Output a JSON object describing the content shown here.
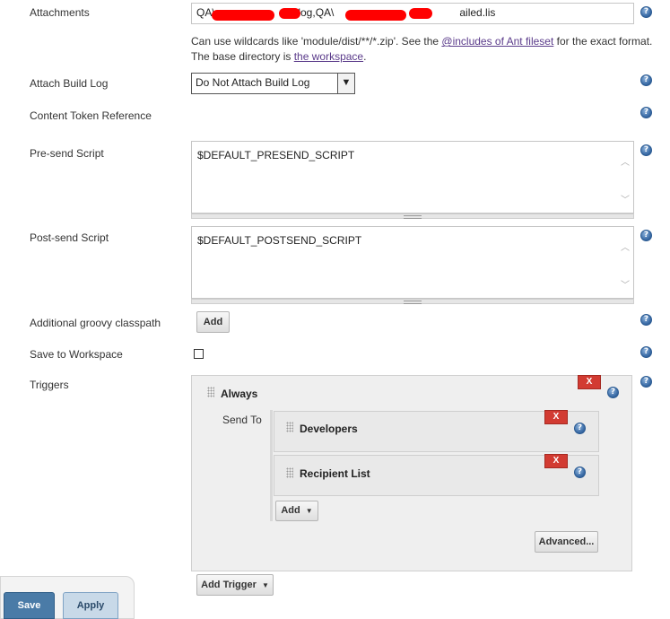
{
  "attachments": {
    "label": "Attachments",
    "value_part1": "QA\\",
    "value_part2": "t.log,QA\\",
    "value_part3": "ailed.lis",
    "hint_line1_pre": "Can use wildcards like 'module/dist/**/*.zip'. See the ",
    "hint_link1": "@includes of Ant fileset",
    "hint_line1_post": " for the exact format.",
    "hint_line2_pre": "The base directory is ",
    "hint_link2": "the workspace",
    "hint_line2_post": "."
  },
  "attach_build_log": {
    "label": "Attach Build Log",
    "selected": "Do Not Attach Build Log",
    "arrow": "▼"
  },
  "content_token": {
    "label": "Content Token Reference"
  },
  "presend": {
    "label": "Pre-send Script",
    "value": "$DEFAULT_PRESEND_SCRIPT"
  },
  "postsend": {
    "label": "Post-send Script",
    "value": "$DEFAULT_POSTSEND_SCRIPT"
  },
  "groovy": {
    "label": "Additional groovy classpath",
    "add_label": "Add"
  },
  "save_workspace": {
    "label": "Save to Workspace",
    "checked": false
  },
  "triggers": {
    "label": "Triggers",
    "trigger_name": "Always",
    "send_to_label": "Send To",
    "recipients": [
      {
        "name": "Developers"
      },
      {
        "name": "Recipient List"
      }
    ],
    "add_label": "Add",
    "advanced_label": "Advanced...",
    "add_trigger_label": "Add Trigger",
    "delete_label": "X"
  },
  "footer": {
    "save_label": "Save",
    "apply_label": "Apply"
  },
  "help_glyph": "?",
  "icons": [
    "help-icon",
    "drag-handle-icon",
    "chevron-down-icon",
    "delete-icon"
  ],
  "colors": {
    "delete_red": "#d23b32",
    "save_blue": "#4a7ba7",
    "link_purple": "#5a3a8a"
  }
}
